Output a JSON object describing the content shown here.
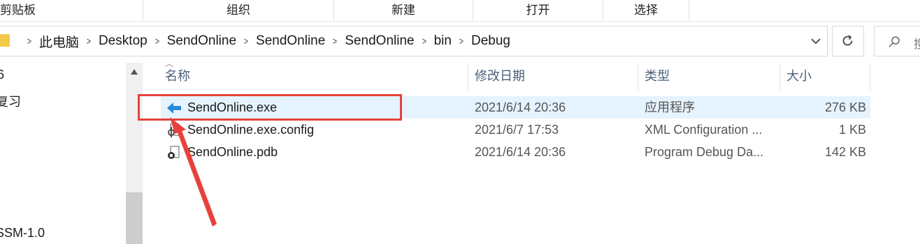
{
  "ribbon": {
    "groups": [
      "剪贴板",
      "组织",
      "新建",
      "打开",
      "选择"
    ]
  },
  "address": {
    "crumbs": [
      "此电脑",
      "Desktop",
      "SendOnline",
      "SendOnline",
      "SendOnline",
      "bin",
      "Debug"
    ]
  },
  "search": {
    "placeholder_fragment": "搜"
  },
  "nav": {
    "items": [
      "6",
      "复习",
      "SSM-1.0"
    ]
  },
  "columns": {
    "name": "名称",
    "date": "修改日期",
    "type": "类型",
    "size": "大小"
  },
  "files": [
    {
      "name": "SendOnline.exe",
      "date": "2021/6/14 20:36",
      "type": "应用程序",
      "size": "276 KB",
      "icon": "exe-arrow-icon",
      "selected": true
    },
    {
      "name": "SendOnline.exe.config",
      "date": "2021/6/7 17:53",
      "type": "XML Configuration ...",
      "size": "1 KB",
      "icon": "config-file-icon",
      "selected": false
    },
    {
      "name": "SendOnline.pdb",
      "date": "2021/6/14 20:36",
      "type": "Program Debug Da...",
      "size": "142 KB",
      "icon": "pdb-file-icon",
      "selected": false
    }
  ],
  "colors": {
    "selection": "#e5f3ff",
    "annotation": "#e8413c",
    "header_text": "#4c607a"
  }
}
